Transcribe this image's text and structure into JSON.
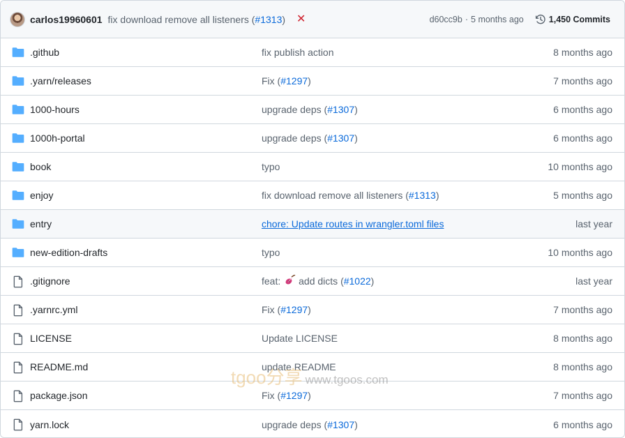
{
  "commit": {
    "author": "carlos19960601",
    "message": "fix download remove all listeners (",
    "pr": "#1313",
    "message_end": ")",
    "status": "✕",
    "sha": "d60cc9b",
    "separator": "·",
    "ago": "5 months ago",
    "commits_label": "1,450 Commits"
  },
  "files": [
    {
      "type": "folder",
      "name": ".github",
      "msg": "fix publish action",
      "pr": "",
      "date": "8 months ago"
    },
    {
      "type": "folder",
      "name": ".yarn/releases",
      "msg": "Fix (",
      "pr": "#1297",
      "date": "7 months ago"
    },
    {
      "type": "folder",
      "name": "1000-hours",
      "msg": "upgrade deps (",
      "pr": "#1307",
      "date": "6 months ago"
    },
    {
      "type": "folder",
      "name": "1000h-portal",
      "msg": "upgrade deps (",
      "pr": "#1307",
      "date": "6 months ago"
    },
    {
      "type": "folder",
      "name": "book",
      "msg": "typo",
      "pr": "",
      "date": "10 months ago"
    },
    {
      "type": "folder",
      "name": "enjoy",
      "msg": "fix download remove all listeners (",
      "pr": "#1313",
      "date": "5 months ago"
    },
    {
      "type": "folder",
      "name": "entry",
      "msg": "chore: Update routes in wrangler.toml files",
      "pr": "",
      "date": "last year",
      "hover": true
    },
    {
      "type": "folder",
      "name": "new-edition-drafts",
      "msg": "typo",
      "pr": "",
      "date": "10 months ago"
    },
    {
      "type": "file",
      "name": ".gitignore",
      "msg": "feat:",
      "emoji": true,
      "msg2": "add dicts (",
      "pr": "#1022",
      "date": "last year"
    },
    {
      "type": "file",
      "name": ".yarnrc.yml",
      "msg": "Fix (",
      "pr": "#1297",
      "date": "7 months ago"
    },
    {
      "type": "file",
      "name": "LICENSE",
      "msg": "Update LICENSE",
      "pr": "",
      "date": "8 months ago"
    },
    {
      "type": "file",
      "name": "README.md",
      "msg": "update README",
      "pr": "",
      "date": "8 months ago"
    },
    {
      "type": "file",
      "name": "package.json",
      "msg": "Fix (",
      "pr": "#1297",
      "date": "7 months ago"
    },
    {
      "type": "file",
      "name": "yarn.lock",
      "msg": "upgrade deps (",
      "pr": "#1307",
      "date": "6 months ago"
    }
  ],
  "close_paren": ")",
  "watermark": {
    "brand": "tgoo分享",
    "site": "www.tgoos.com"
  },
  "colors": {
    "link": "#0969da",
    "folder": "#54aeff",
    "muted": "#59636e",
    "fail": "#cf222e"
  }
}
